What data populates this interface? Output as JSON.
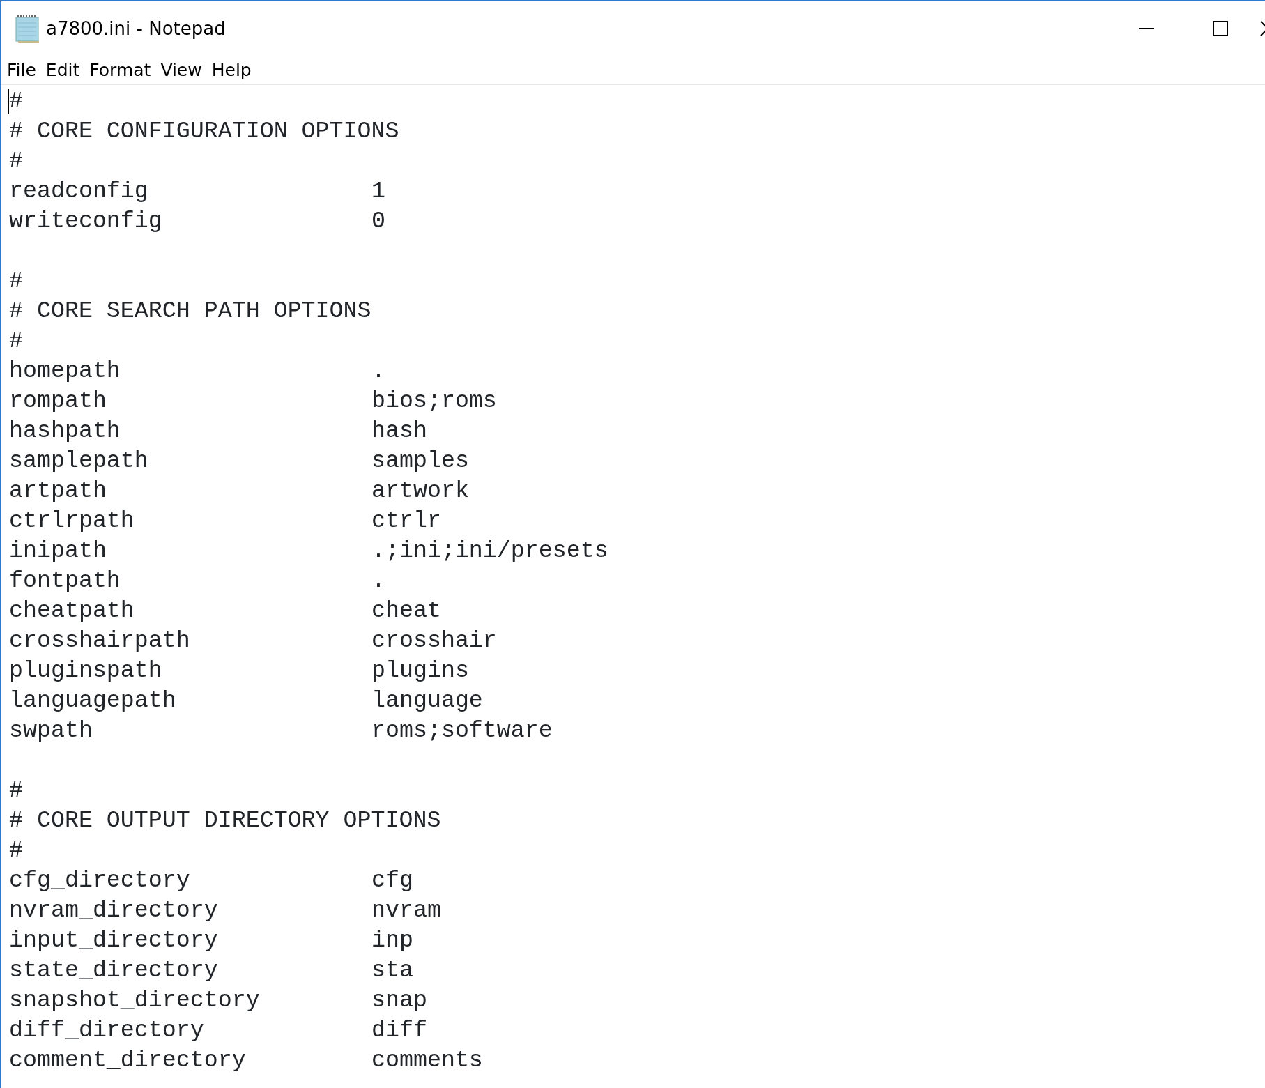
{
  "window": {
    "title": "a7800.ini - Notepad"
  },
  "menu": [
    "File",
    "Edit",
    "Format",
    "View",
    "Help"
  ],
  "lines": [
    {
      "kind": "comment",
      "text": "#"
    },
    {
      "kind": "comment",
      "text": "# CORE CONFIGURATION OPTIONS"
    },
    {
      "kind": "comment",
      "text": "#"
    },
    {
      "kind": "setting",
      "key": "readconfig",
      "value": "1"
    },
    {
      "kind": "setting",
      "key": "writeconfig",
      "value": "0"
    },
    {
      "kind": "blank"
    },
    {
      "kind": "comment",
      "text": "#"
    },
    {
      "kind": "comment",
      "text": "# CORE SEARCH PATH OPTIONS"
    },
    {
      "kind": "comment",
      "text": "#"
    },
    {
      "kind": "setting",
      "key": "homepath",
      "value": "."
    },
    {
      "kind": "setting",
      "key": "rompath",
      "value": "bios;roms"
    },
    {
      "kind": "setting",
      "key": "hashpath",
      "value": "hash"
    },
    {
      "kind": "setting",
      "key": "samplepath",
      "value": "samples"
    },
    {
      "kind": "setting",
      "key": "artpath",
      "value": "artwork"
    },
    {
      "kind": "setting",
      "key": "ctrlrpath",
      "value": "ctrlr"
    },
    {
      "kind": "setting",
      "key": "inipath",
      "value": ".;ini;ini/presets"
    },
    {
      "kind": "setting",
      "key": "fontpath",
      "value": "."
    },
    {
      "kind": "setting",
      "key": "cheatpath",
      "value": "cheat"
    },
    {
      "kind": "setting",
      "key": "crosshairpath",
      "value": "crosshair"
    },
    {
      "kind": "setting",
      "key": "pluginspath",
      "value": "plugins"
    },
    {
      "kind": "setting",
      "key": "languagepath",
      "value": "language"
    },
    {
      "kind": "setting",
      "key": "swpath",
      "value": "roms;software"
    },
    {
      "kind": "blank"
    },
    {
      "kind": "comment",
      "text": "#"
    },
    {
      "kind": "comment",
      "text": "# CORE OUTPUT DIRECTORY OPTIONS"
    },
    {
      "kind": "comment",
      "text": "#"
    },
    {
      "kind": "setting",
      "key": "cfg_directory",
      "value": "cfg"
    },
    {
      "kind": "setting",
      "key": "nvram_directory",
      "value": "nvram"
    },
    {
      "kind": "setting",
      "key": "input_directory",
      "value": "inp"
    },
    {
      "kind": "setting",
      "key": "state_directory",
      "value": "sta"
    },
    {
      "kind": "setting",
      "key": "snapshot_directory",
      "value": "snap"
    },
    {
      "kind": "setting",
      "key": "diff_directory",
      "value": "diff"
    },
    {
      "kind": "setting",
      "key": "comment_directory",
      "value": "comments"
    }
  ]
}
